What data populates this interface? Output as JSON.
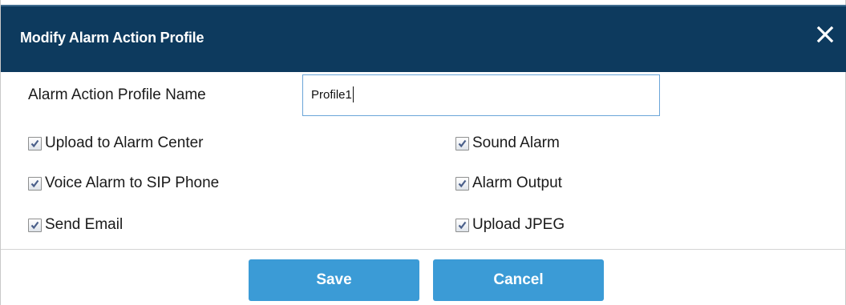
{
  "dialog": {
    "title": "Modify Alarm Action Profile",
    "close_icon": "close-icon"
  },
  "profile_name": {
    "label": "Alarm Action Profile Name",
    "value": "Profile1"
  },
  "options": [
    {
      "label": "Upload to Alarm Center",
      "checked": true
    },
    {
      "label": "Sound Alarm",
      "checked": true
    },
    {
      "label": "Voice Alarm to SIP Phone",
      "checked": true
    },
    {
      "label": "Alarm Output",
      "checked": true
    },
    {
      "label": "Send Email",
      "checked": true
    },
    {
      "label": "Upload JPEG",
      "checked": true
    }
  ],
  "buttons": {
    "save_label": "Save",
    "cancel_label": "Cancel"
  },
  "colors": {
    "titlebar": "#0d3a5e",
    "button": "#3b9bd6",
    "input_border": "#6aa5d8"
  }
}
